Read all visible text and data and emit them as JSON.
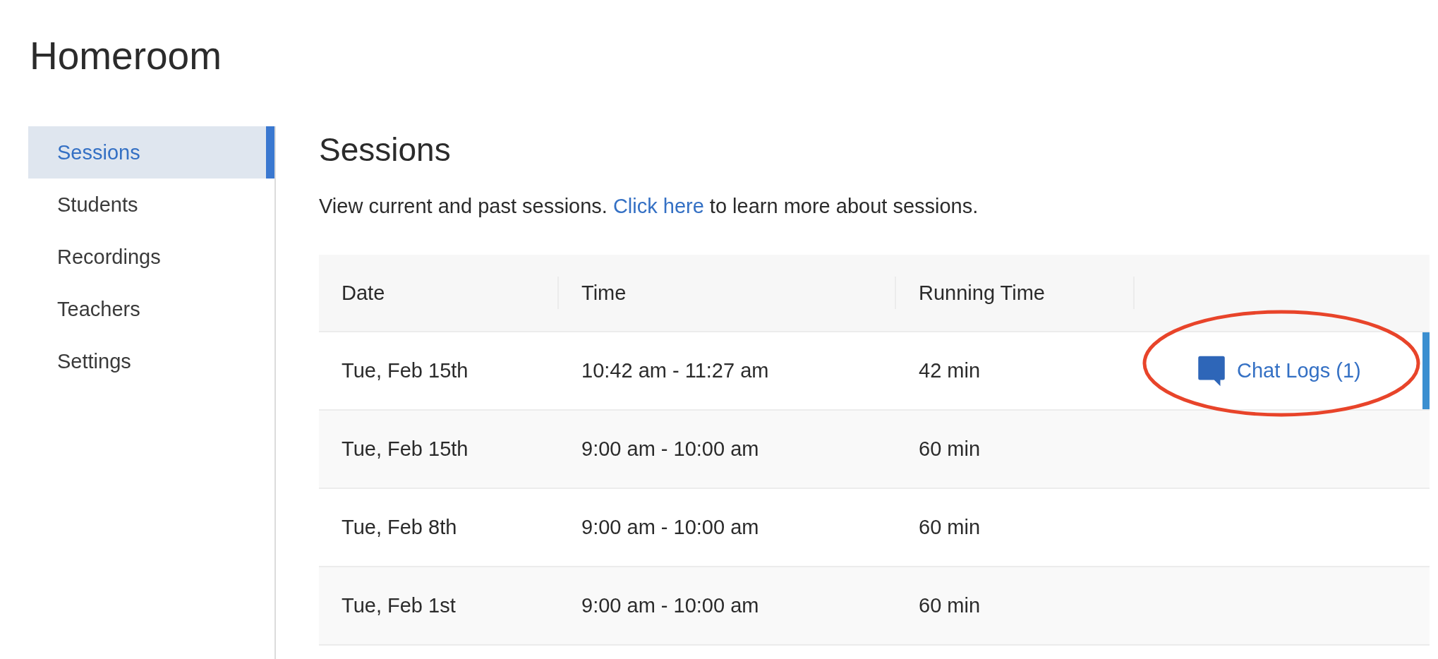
{
  "app_title": "Homeroom",
  "sidebar": {
    "items": [
      {
        "label": "Sessions",
        "selected": true
      },
      {
        "label": "Students",
        "selected": false
      },
      {
        "label": "Recordings",
        "selected": false
      },
      {
        "label": "Teachers",
        "selected": false
      },
      {
        "label": "Settings",
        "selected": false
      }
    ]
  },
  "page": {
    "heading": "Sessions",
    "description_before": "View current and past sessions.",
    "link": "Click here",
    "description_after": "to learn more about sessions."
  },
  "table": {
    "columns": [
      "Date",
      "Time",
      "Running Time"
    ],
    "rows": [
      {
        "date": "Tue, Feb 15th",
        "time": "10:42 am - 11:27 am",
        "running_time": "42 min",
        "chat_logs": "Chat Logs (1)",
        "selected": true
      },
      {
        "date": "Tue, Feb 15th",
        "time": "9:00 am - 10:00 am",
        "running_time": "60 min",
        "selected": false
      },
      {
        "date": "Tue, Feb 8th",
        "time": "9:00 am - 10:00 am",
        "running_time": "60 min",
        "selected": false
      },
      {
        "date": "Tue, Feb 1st",
        "time": "9:00 am - 10:00 am",
        "running_time": "60 min",
        "selected": false
      }
    ]
  }
}
